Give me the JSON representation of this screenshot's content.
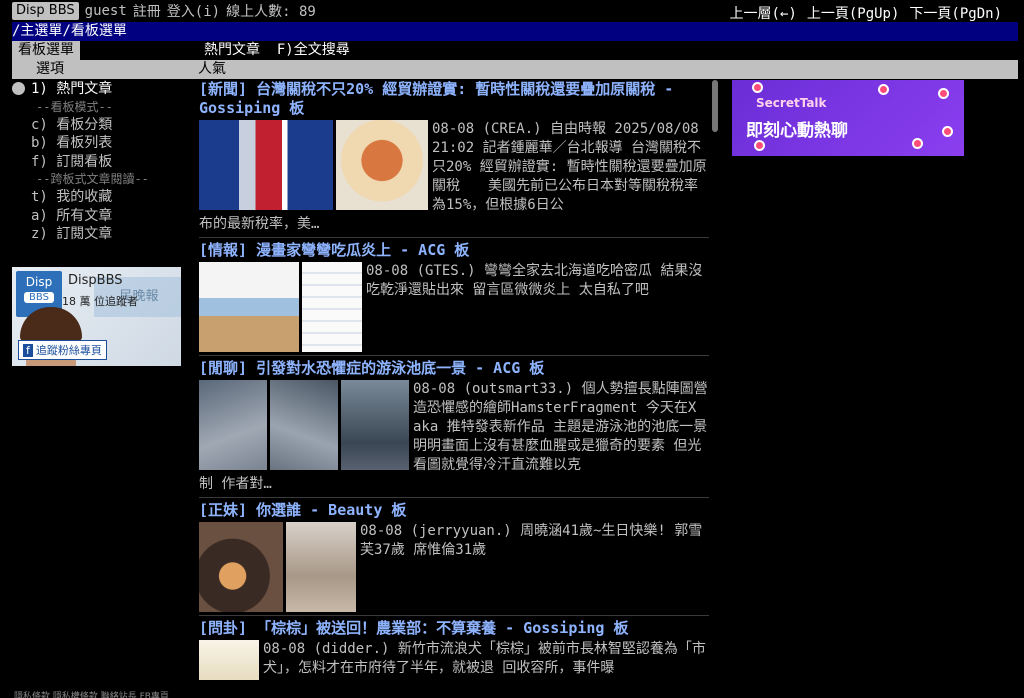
{
  "topbar": {
    "logo": "Disp BBS",
    "user": "guest",
    "register": "註冊",
    "login": "登入(i)",
    "online": "線上人數: 89",
    "nav_up": "上一層(←)",
    "nav_prev": "上一頁(PgUp)",
    "nav_next": "下一頁(PgDn)"
  },
  "path": {
    "main": "/主選單",
    "board": "/看板選單"
  },
  "tabs": {
    "active": "看板選單",
    "hot": "熱門文章",
    "search": "F)全文搜尋"
  },
  "colhead": {
    "option": "選項",
    "popularity": "人氣"
  },
  "menu": {
    "hot": "1) 熱門文章",
    "sep_board": "--看板模式--",
    "classify": "c) 看板分類",
    "boardlist": "b) 看板列表",
    "subscribe": "f) 訂閱看板",
    "sep_cross": "--跨板式文章閱讀--",
    "favorites": "t) 我的收藏",
    "all": "a) 所有文章",
    "subscribed": "z) 訂閱文章"
  },
  "left_ad": {
    "logo_top": "Disp",
    "logo_bottom": "BBS",
    "name": "DispBBS",
    "count": "18 萬 位追蹤者",
    "overlay": "民晚報",
    "fb": "追蹤粉絲專頁"
  },
  "articles": [
    {
      "title": "[新聞] 台灣關稅不只20% 經貿辦證實: 暫時性關稅還要疊加原關稅 - Gossiping 板",
      "snippet": "08-08 (CREA.) 自由時報 2025/08/08 21:02 記者鍾麗華／台北報導 台灣關稅不只20% 經貿辦證實: 暫時性關稅還要疊加原關稅　　美國先前已公布日本對等關稅稅率為15%，但根據6日公",
      "tail": "布的最新稅率，美…"
    },
    {
      "title": "[情報] 漫畫家彎彎吃瓜炎上 - ACG 板",
      "snippet": "08-08 (GTES.) 彎彎全家去北海道吃哈密瓜 結果沒吃乾淨還貼出來 留言區微微炎上 太自私了吧",
      "tail": ""
    },
    {
      "title": "[閒聊] 引發對水恐懼症的游泳池底一景 - ACG 板",
      "snippet": "08-08 (outsmart33.) 個人勢擅長點陣圖營造恐懼感的繪師HamsterFragment 今天在X aka 推特發表新作品 主題是游泳池的池底一景 明明畫面上沒有甚麼血腥或是獵奇的要素 但光看圖就覺得冷汗直流難以克",
      "tail": "制 作者對…"
    },
    {
      "title": "[正妹] 你選誰 - Beauty 板",
      "snippet": "08-08 (jerryyuan.) 周曉涵41歲~生日快樂! 郭雪芙37歲 席惟倫31歲",
      "tail": ""
    },
    {
      "title": "[問卦] 「棕棕」被送回！農業部：不算棄養 - Gossiping 板",
      "snippet": "08-08 (didder.) 新竹市流浪犬「棕棕」被前市長林智堅認養為「市犬」，怎料才在市府待了半年，就被退 回收容所，事件曝",
      "tail": ""
    }
  ],
  "right_ad": {
    "brand": "SecretTalk",
    "slogan": "即刻心動熱聊"
  },
  "footer": {
    "text": "隱私條款 隱私權條款 聯絡站長 FB專頁"
  }
}
